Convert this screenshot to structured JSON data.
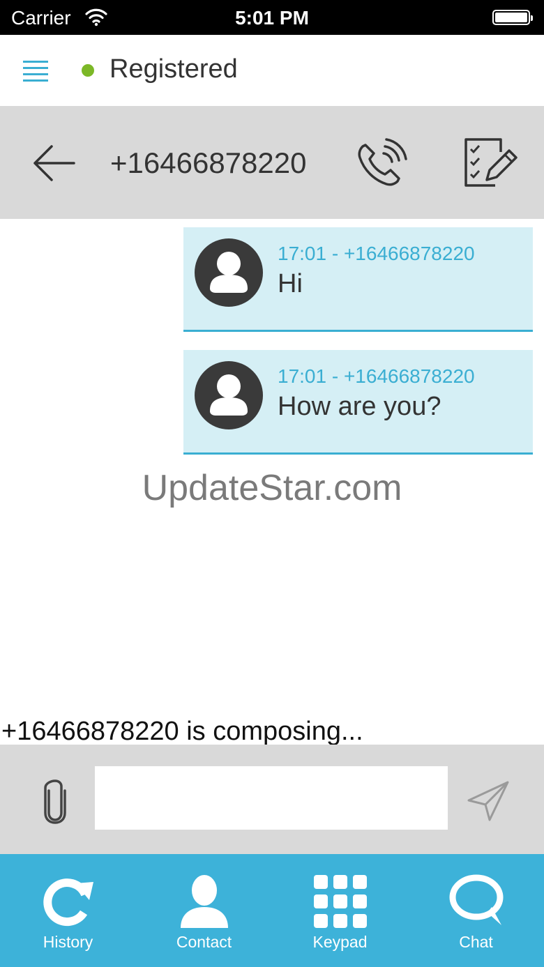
{
  "status_bar": {
    "carrier": "Carrier",
    "time": "5:01 PM"
  },
  "top_bar": {
    "registration_status": "Registered",
    "status_color": "#7cb827"
  },
  "conversation": {
    "contact_number": "+16466878220"
  },
  "messages": [
    {
      "meta": "17:01 - +16466878220",
      "text": "Hi"
    },
    {
      "meta": "17:01 - +16466878220",
      "text": "How are you?"
    }
  ],
  "watermark": "UpdateStar.com",
  "composing_text": "+16466878220 is composing...",
  "input": {
    "value": "",
    "placeholder": ""
  },
  "tabs": [
    {
      "label": "History",
      "icon": "history-icon"
    },
    {
      "label": "Contact",
      "icon": "contact-icon"
    },
    {
      "label": "Keypad",
      "icon": "keypad-icon"
    },
    {
      "label": "Chat",
      "icon": "chat-icon"
    }
  ],
  "colors": {
    "accent": "#3db2d9",
    "bubble": "#d5eff5",
    "header_gray": "#d9d9d9"
  }
}
